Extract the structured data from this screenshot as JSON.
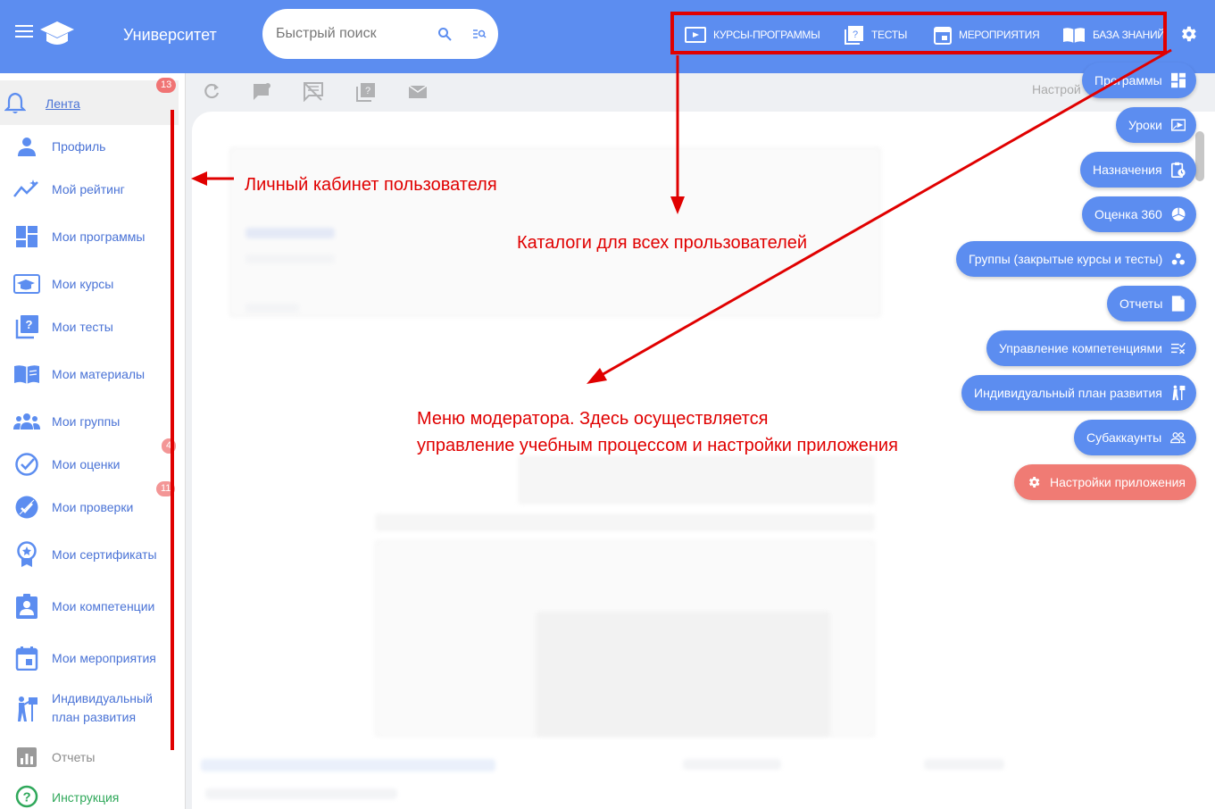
{
  "header": {
    "app_title": "Университет",
    "search_placeholder": "Быстрый поиск",
    "catalogs": [
      {
        "label": "КУРСЫ-ПРОГРАММЫ",
        "icon": "courses-icon"
      },
      {
        "label": "ТЕСТЫ",
        "icon": "tests-icon"
      },
      {
        "label": "МЕРОПРИЯТИЯ",
        "icon": "calendar-icon"
      },
      {
        "label": "БАЗА ЗНАНИЙ",
        "icon": "book-icon"
      }
    ]
  },
  "sidebar": {
    "items": [
      {
        "label": "Лента",
        "icon": "bell-icon",
        "badge": "13"
      },
      {
        "label": "Профиль",
        "icon": "person-icon"
      },
      {
        "label": "Мой рейтинг",
        "icon": "rating-icon"
      },
      {
        "label": "Мои программы",
        "icon": "dashboard-icon"
      },
      {
        "label": "Мои курсы",
        "icon": "courses-icon"
      },
      {
        "label": "Мои тесты",
        "icon": "tests-icon"
      },
      {
        "label": "Мои материалы",
        "icon": "book-icon"
      },
      {
        "label": "Мои группы",
        "icon": "group-icon"
      },
      {
        "label": "Мои оценки",
        "icon": "check-circle-icon",
        "badge": "4"
      },
      {
        "label": "Мои проверки",
        "icon": "review-icon",
        "badge": "11"
      },
      {
        "label": "Мои сертификаты",
        "icon": "certificate-icon"
      },
      {
        "label": "Мои компетенции",
        "icon": "badge-icon"
      },
      {
        "label": "Мои мероприятия",
        "icon": "calendar-icon"
      },
      {
        "label": "Индивидуальный",
        "label2": "план развития",
        "icon": "plan-icon"
      },
      {
        "label": "Отчеты",
        "icon": "chart-icon"
      },
      {
        "label": "Инструкция",
        "icon": "help-icon"
      }
    ]
  },
  "content": {
    "settings_label": "Настрой"
  },
  "moderator_menu": [
    {
      "label": "Программы",
      "icon": "dashboard-icon"
    },
    {
      "label": "Уроки",
      "icon": "lesson-icon"
    },
    {
      "label": "Назначения",
      "icon": "assignment-icon"
    },
    {
      "label": "Оценка 360",
      "icon": "pie-icon"
    },
    {
      "label": "Группы (закрытые курсы и тесты)",
      "icon": "dots-icon"
    },
    {
      "label": "Отчеты",
      "icon": "file-icon"
    },
    {
      "label": "Управление компетенциями",
      "icon": "checklist-icon"
    },
    {
      "label": "Индивидуальный план развития",
      "icon": "plan-icon"
    },
    {
      "label": "Субаккаунты",
      "icon": "users-icon"
    },
    {
      "label": "Настройки приложения",
      "icon": "gear-icon"
    }
  ],
  "annotations": {
    "cabinet": "Личный кабинет пользователя",
    "catalogs": "Каталоги для всех прользователей",
    "moderator_line1": "Меню модератора. Здесь осуществляется",
    "moderator_line2": "управление учебным процессом и настройки приложения"
  },
  "colors": {
    "topbar": "#5c8df0",
    "nav_text": "#4a73d6",
    "badge": "#f07474",
    "annotation": "#e00000",
    "settings_button": "#f07b74"
  }
}
